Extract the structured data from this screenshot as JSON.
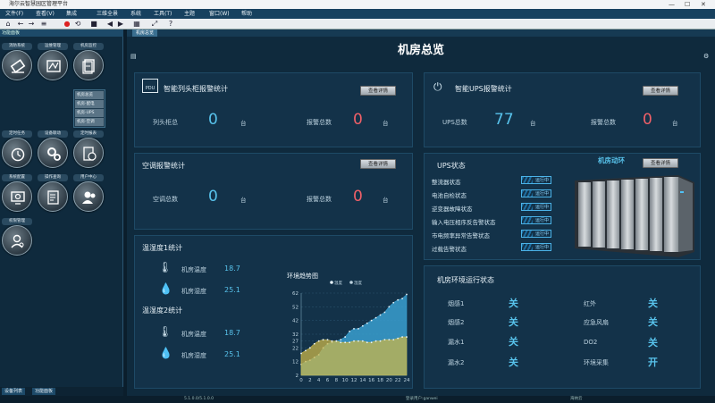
{
  "window": {
    "title": "海尔云智慧园区管理平台",
    "minimize": "—",
    "maximize": "☐",
    "close": "✕"
  },
  "menu": [
    "文件(F)",
    "查看(V)",
    "集成",
    "三维全景",
    "系统",
    "工具(T)",
    "主题",
    "窗口(W)",
    "帮助"
  ],
  "left_panel": {
    "header": "功能面板",
    "icons": [
      {
        "label": "消防系统"
      },
      {
        "label": "运维管理"
      },
      {
        "label": "机房监控"
      },
      {
        "label": "定时任务"
      },
      {
        "label": "设备联动"
      },
      {
        "label": "定时报表"
      },
      {
        "label": "系统配置"
      },
      {
        "label": "操作查询"
      },
      {
        "label": "用户中心"
      },
      {
        "label": "权限管理"
      }
    ],
    "submenu": [
      "机房总览",
      "机房-配电",
      "机房-UPS",
      "机房-空调"
    ],
    "bottom_tabs": [
      "设备列表",
      "功能面板"
    ]
  },
  "main": {
    "tab": "机房总览",
    "title": "机房总览",
    "pdu": {
      "title": "智能列头柜报警统计",
      "icon_text": "PDU",
      "detail_btn": "查看详情",
      "total_label": "列头柜总",
      "total_value": "0",
      "total_unit": "台",
      "alarm_label": "报警总数",
      "alarm_value": "0",
      "alarm_unit": "台"
    },
    "ups": {
      "title": "智能UPS报警统计",
      "detail_btn": "查看详情",
      "total_label": "UPS总数",
      "total_value": "77",
      "total_unit": "台",
      "alarm_label": "报警总数",
      "alarm_value": "0",
      "alarm_unit": "台"
    },
    "ac": {
      "title": "空调报警统计",
      "detail_btn": "查看详情",
      "total_label": "空调总数",
      "total_value": "0",
      "total_unit": "台",
      "alarm_label": "报警总数",
      "alarm_value": "0",
      "alarm_unit": "台"
    },
    "ups_status": {
      "title": "UPS状态",
      "dynamic_label": "机房动环",
      "detail_btn": "查看详情",
      "rows": [
        {
          "label": "整流器状态",
          "status": "运行中"
        },
        {
          "label": "电池自检状态",
          "status": "运行中"
        },
        {
          "label": "逆变器故障状态",
          "status": "运行中"
        },
        {
          "label": "输入电压相序反告警状态",
          "status": "运行中"
        },
        {
          "label": "市电频率异常告警状态",
          "status": "运行中"
        },
        {
          "label": "过载告警状态",
          "status": "运行中"
        }
      ]
    },
    "temp1": {
      "title": "温湿度1统计",
      "temp_label": "机房温度",
      "temp_value": "18.7",
      "hum_label": "机房湿度",
      "hum_value": "25.1"
    },
    "temp2": {
      "title": "温湿度2统计",
      "temp_label": "机房温度",
      "temp_value": "18.7",
      "hum_label": "机房湿度",
      "hum_value": "25.1"
    },
    "env_status": {
      "title": "机房环境运行状态",
      "items": [
        {
          "label": "烟感1",
          "value": "关"
        },
        {
          "label": "红外",
          "value": "关"
        },
        {
          "label": "烟感2",
          "value": "关"
        },
        {
          "label": "应急风扇",
          "value": "关"
        },
        {
          "label": "漏水1",
          "value": "关"
        },
        {
          "label": "DO2",
          "value": "关"
        },
        {
          "label": "漏水2",
          "value": "关"
        },
        {
          "label": "环境采集",
          "value": "开"
        }
      ]
    }
  },
  "chart_data": {
    "type": "area",
    "title": "环境趋势图",
    "series": [
      {
        "name": "温度",
        "color": "#3a9fcf",
        "values": [
          10,
          12,
          13,
          15,
          17,
          22,
          25,
          26,
          27,
          28,
          30,
          34,
          36,
          36,
          38,
          40,
          42,
          44,
          46,
          48,
          52,
          55,
          57,
          58,
          61
        ]
      },
      {
        "name": "湿度",
        "color": "#c9b64a",
        "values": [
          18,
          20,
          22,
          25,
          27,
          28,
          28,
          27,
          27,
          26,
          26,
          26,
          27,
          27,
          27,
          26,
          26,
          27,
          27,
          28,
          28,
          28,
          29,
          30,
          30
        ]
      }
    ],
    "x": [
      0,
      1,
      2,
      3,
      4,
      5,
      6,
      7,
      8,
      9,
      10,
      11,
      12,
      13,
      14,
      15,
      16,
      17,
      18,
      19,
      20,
      21,
      22,
      23,
      24
    ],
    "x_ticks": [
      0,
      2,
      4,
      6,
      8,
      10,
      12,
      14,
      16,
      18,
      20,
      22,
      24
    ],
    "y_ticks": [
      2,
      12,
      22,
      27,
      32,
      42,
      52,
      62
    ],
    "ylim": [
      2,
      62
    ],
    "grid": true,
    "legend": "top"
  },
  "statusbar": {
    "version": "5.1.0.0/5.1.0.0",
    "user": "登录用户:ganwei",
    "org": "海纳云"
  }
}
